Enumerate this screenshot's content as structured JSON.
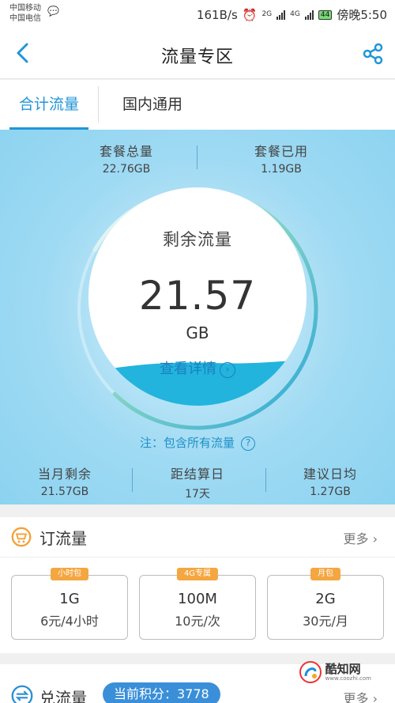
{
  "status_bar": {
    "carrier1": "中国移动",
    "carrier2": "中国电信",
    "speed": "161B/s",
    "net1": "2G",
    "net2": "4G",
    "battery": "44",
    "time": "傍晚5:50"
  },
  "header": {
    "title": "流量专区"
  },
  "tabs": [
    {
      "label": "合计流量",
      "active": true
    },
    {
      "label": "国内通用",
      "active": false
    }
  ],
  "summary": {
    "total_label": "套餐总量",
    "total_value": "22.76GB",
    "used_label": "套餐已用",
    "used_value": "1.19GB"
  },
  "gauge": {
    "label": "剩余流量",
    "value": "21.57",
    "unit": "GB",
    "detail_link": "查看详情",
    "remaining_fraction": 0.948
  },
  "note": "注：包含所有流量",
  "stats": [
    {
      "label": "当月剩余",
      "value": "21.57GB"
    },
    {
      "label": "距结算日",
      "value": "17天"
    },
    {
      "label": "建议日均",
      "value": "1.27GB"
    }
  ],
  "order_section": {
    "title": "订流量",
    "more": "更多",
    "packages": [
      {
        "tag": "小时包",
        "amount": "1G",
        "price": "6元/4小时"
      },
      {
        "tag": "4G专属",
        "amount": "100M",
        "price": "10元/次"
      },
      {
        "tag": "月包",
        "amount": "2G",
        "price": "30元/月"
      }
    ]
  },
  "exchange_section": {
    "title": "兑流量",
    "points": "当前积分：3778",
    "more": "更多"
  },
  "watermark": {
    "text": "酷知网",
    "sub": "www.coozhi.com"
  },
  "colors": {
    "accent": "#2196d8",
    "hero_bg": "#9fdaf3",
    "wave": "#22b4dc",
    "tag": "#f4a640"
  }
}
